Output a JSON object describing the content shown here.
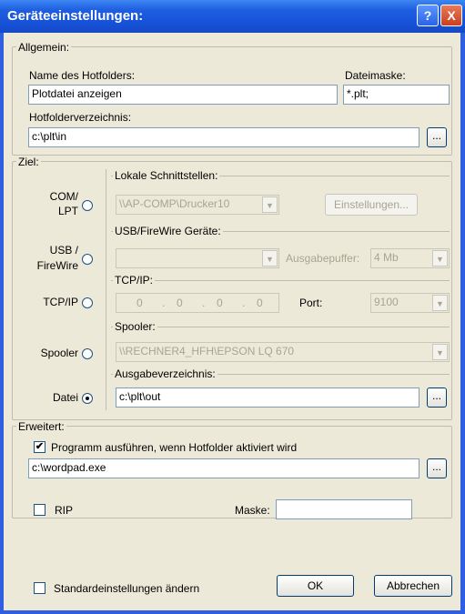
{
  "title": "Geräteeinstellungen:",
  "titlebar": {
    "help_label": "?",
    "close_label": "X"
  },
  "allgemein": {
    "legend": "Allgemein:",
    "hotfolder_name_label": "Name des Hotfolders:",
    "hotfolder_name_value": "Plotdatei anzeigen",
    "dateimaske_label": "Dateimaske:",
    "dateimaske_value": "*.plt;",
    "hotfolderverzeichnis_label": "Hotfolderverzeichnis:",
    "hotfolderverzeichnis_value": "c:\\plt\\in",
    "browse_label": "..."
  },
  "ziel": {
    "legend": "Ziel:",
    "radio_com_line1": "COM/",
    "radio_com_line2": "LPT",
    "radio_usb_line1": "USB /",
    "radio_usb_line2": "FireWire",
    "radio_tcp": "TCP/IP",
    "radio_spooler": "Spooler",
    "radio_datei": "Datei",
    "selected": "Datei",
    "lokale": {
      "legend": "Lokale Schnittstellen:",
      "combo_value": "\\\\AP-COMP\\Drucker10",
      "einstellungen_label": "Einstellungen..."
    },
    "usb": {
      "legend": "USB/FireWire Geräte:",
      "combo_value": "",
      "ausgabepuffer_label": "Ausgabepuffer:",
      "ausgabepuffer_value": "4 Mb"
    },
    "tcp": {
      "legend": "TCP/IP:",
      "ip_octets": [
        "0",
        "0",
        "0",
        "0"
      ],
      "port_label": "Port:",
      "port_value": "9100"
    },
    "spooler": {
      "legend": "Spooler:",
      "combo_value": "\\\\RECHNER4_HFH\\EPSON LQ 670"
    },
    "ausgabe": {
      "legend": "Ausgabeverzeichnis:",
      "value": "c:\\plt\\out",
      "browse_label": "..."
    }
  },
  "erweitert": {
    "legend": "Erweitert:",
    "programm_checkbox_label": "Programm ausführen, wenn Hotfolder aktiviert wird",
    "programm_checked": true,
    "programm_value": "c:\\wordpad.exe",
    "browse_label": "...",
    "rip_label": "RIP",
    "rip_checked": false,
    "maske_label": "Maske:",
    "maske_value": ""
  },
  "footer": {
    "standard_label": "Standardeinstellungen ändern",
    "standard_checked": false,
    "ok_label": "OK",
    "cancel_label": "Abbrechen"
  },
  "colors": {
    "titlebar": "#1f5fe0",
    "dialog_background": "#ece9d8",
    "disabled_text": "#a7a592"
  }
}
